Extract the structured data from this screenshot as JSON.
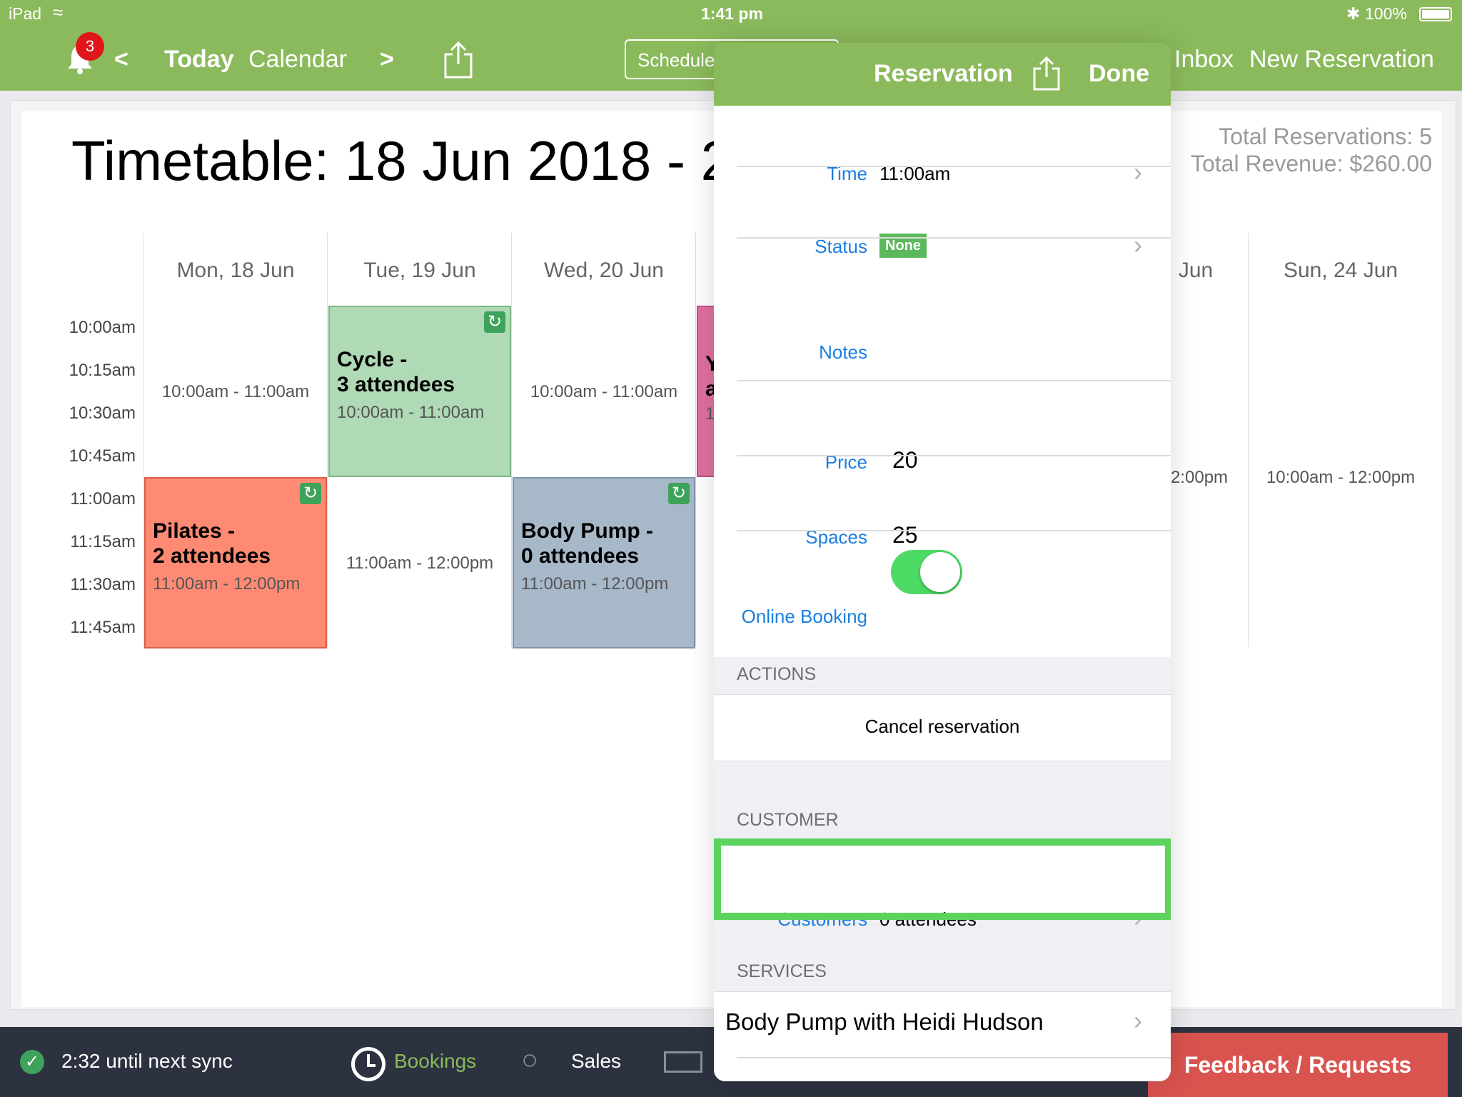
{
  "status_bar": {
    "device": "iPad",
    "time": "1:41 pm",
    "battery": "100%"
  },
  "nav": {
    "notification_count": "3",
    "prev": "<",
    "today": "Today",
    "calendar": "Calendar",
    "next": ">",
    "segment_label": "Schedule",
    "inbox": "Inbox",
    "new_reservation": "New Reservation"
  },
  "timetable": {
    "title": "Timetable: 18 Jun 2018 - 24",
    "total_reservations": "Total Reservations: 5",
    "total_revenue": "Total Revenue: $260.00",
    "days": [
      "Mon, 18 Jun",
      "Tue, 19 Jun",
      "Wed, 20 Jun",
      "Jun",
      "Sun, 24 Jun"
    ],
    "times": [
      "10:00am",
      "10:15am",
      "10:30am",
      "10:45am",
      "11:00am",
      "11:15am",
      "11:30am",
      "11:45am"
    ],
    "slots": {
      "mon_10": "10:00am - 11:00am",
      "tue_11": "11:00am - 12:00pm",
      "wed_10": "10:00am - 11:00am",
      "sat_partial": "2:00pm",
      "sun_10": "10:00am - 12:00pm"
    },
    "events": [
      {
        "title": "Cycle -\n3 attendees",
        "time": "10:00am - 11:00am",
        "color": "#b0d9b5"
      },
      {
        "title": "Pilates -\n2 attendees",
        "time": "11:00am - 12:00pm",
        "color": "#ff8a73"
      },
      {
        "title": "Body Pump -\n0 attendees",
        "time": "11:00am - 12:00pm",
        "color": "#a7b8c9"
      }
    ],
    "partial_event": {
      "title_a": "Y",
      "title_b": "a",
      "time": "1",
      "color": "#e0709f"
    }
  },
  "bottom_bar": {
    "sync": "2:32 until next sync",
    "bookings": "Bookings",
    "sales": "Sales",
    "feedback": "Feedback / Requests"
  },
  "reservation": {
    "header_title": "Reservation",
    "done": "Done",
    "time_label": "Time",
    "time_value": "11:00am",
    "status_label": "Status",
    "status_value": "None",
    "notes_label": "Notes",
    "price_label": "Price",
    "price_value": "20",
    "spaces_label": "Spaces",
    "spaces_value": "25",
    "online_booking_label": "Online Booking",
    "online_booking_on": true,
    "actions_header": "ACTIONS",
    "cancel": "Cancel reservation",
    "customer_header": "CUSTOMER",
    "customers_label": "Customers",
    "customers_value": "0 attendees",
    "services_header": "SERVICES",
    "service_item": "Body Pump with Heidi Hudson"
  },
  "colors": {
    "brand_green": "#8bba5c",
    "link_blue": "#1a7fe0",
    "highlight_green": "#5cd35c",
    "feedback_red": "#d9534f"
  }
}
